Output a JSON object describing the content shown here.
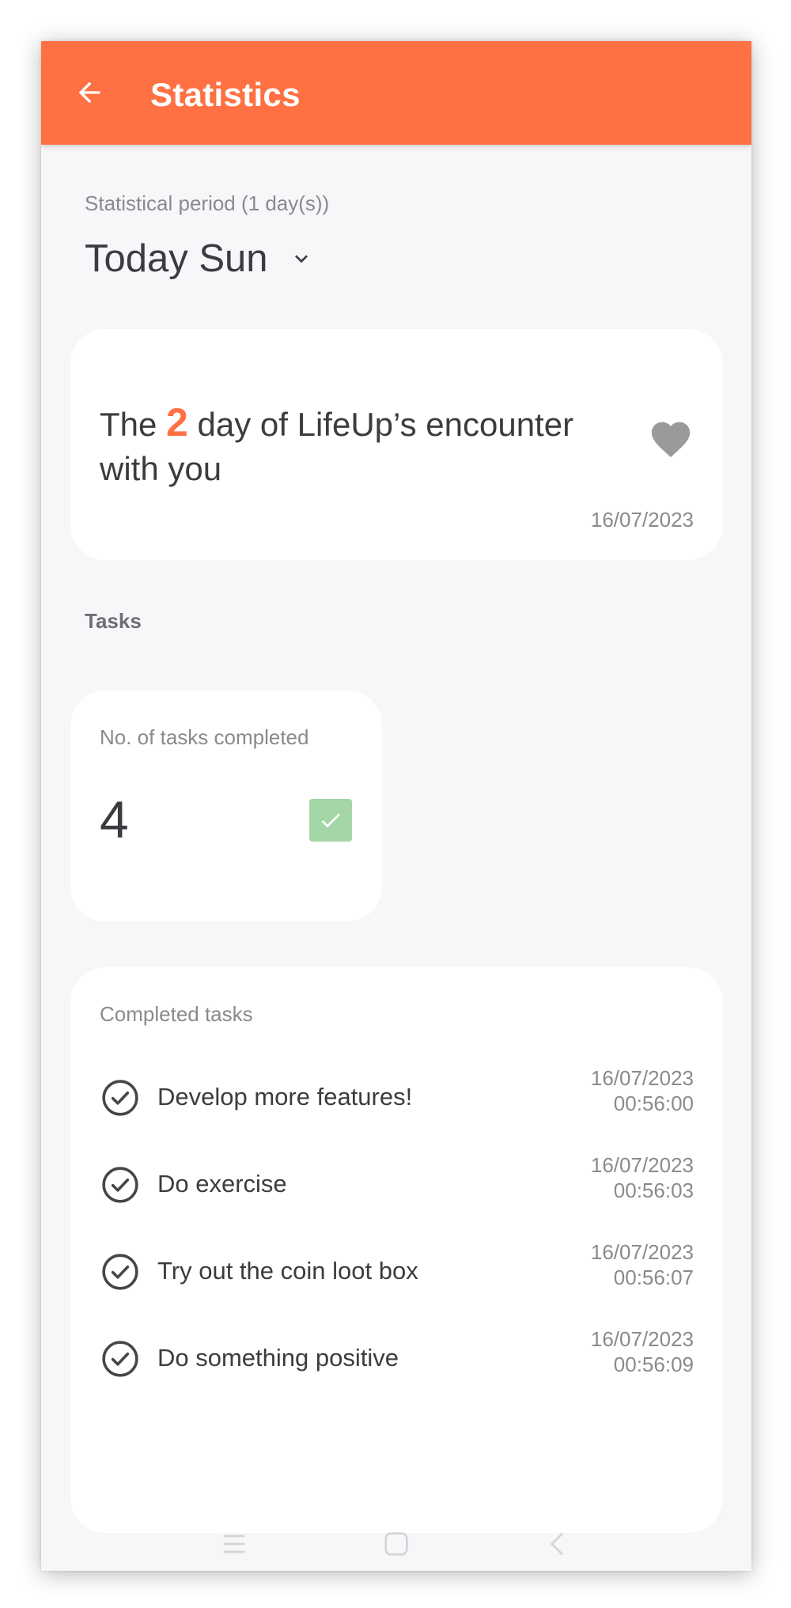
{
  "app_bar": {
    "title": "Statistics",
    "back_icon": "arrow-left-icon",
    "color": "#ff7043"
  },
  "period": {
    "label": "Statistical period (1 day(s))",
    "value": "Today Sun"
  },
  "encounter": {
    "text_before": "The ",
    "day_number": "2",
    "text_after": " day of LifeUp’s encounter with you",
    "date": "16/07/2023",
    "icon": "heart-icon"
  },
  "tasks_section": {
    "title": "Tasks"
  },
  "tasks_completed": {
    "label": "No. of tasks completed",
    "value": "4",
    "icon": "check-square-icon",
    "icon_color": "#a5d6a7"
  },
  "completed_tasks": {
    "label": "Completed tasks",
    "items": [
      {
        "name": "Develop more features!",
        "date": "16/07/2023",
        "time": "00:56:00"
      },
      {
        "name": "Do exercise",
        "date": "16/07/2023",
        "time": "00:56:03"
      },
      {
        "name": "Try out the coin loot box",
        "date": "16/07/2023",
        "time": "00:56:07"
      },
      {
        "name": "Do something positive",
        "date": "16/07/2023",
        "time": "00:56:09"
      }
    ]
  },
  "nav_bar": {
    "icons": [
      "menu-icon",
      "home-icon",
      "back-icon"
    ]
  }
}
